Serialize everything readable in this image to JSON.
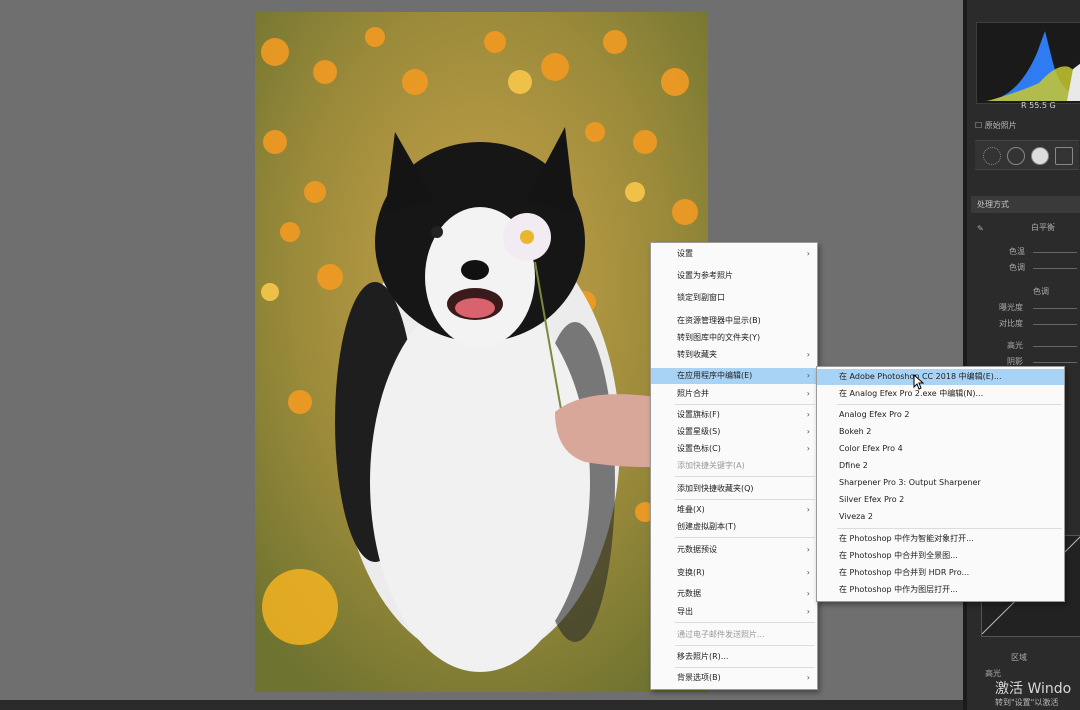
{
  "context_menu": {
    "items": [
      {
        "label": "设置",
        "submenu": true
      },
      {
        "label": "设置为参考照片"
      },
      {
        "label": "锁定到副窗口"
      },
      {
        "label": "在资源管理器中显示(B)"
      },
      {
        "label": "转到图库中的文件夹(Y)"
      },
      {
        "label": "转到收藏夹",
        "submenu": true
      },
      {
        "label": "在应用程序中编辑(E)",
        "submenu": true,
        "highlighted": true
      },
      {
        "label": "照片合并",
        "submenu": true
      },
      {
        "label": "设置旗标(F)",
        "submenu": true
      },
      {
        "label": "设置星级(S)",
        "submenu": true
      },
      {
        "label": "设置色标(C)",
        "submenu": true
      },
      {
        "label": "添加快捷关键字(A)",
        "disabled": true
      },
      {
        "label": "添加到快捷收藏夹(Q)"
      },
      {
        "label": "堆叠(X)",
        "submenu": true
      },
      {
        "label": "创建虚拟副本(T)"
      },
      {
        "label": "元数据预设",
        "submenu": true
      },
      {
        "label": "变换(R)",
        "submenu": true
      },
      {
        "label": "元数据",
        "submenu": true
      },
      {
        "label": "导出",
        "submenu": true
      },
      {
        "label": "通过电子邮件发送照片...",
        "disabled": true
      },
      {
        "label": "移去照片(R)..."
      },
      {
        "label": "背景选项(B)",
        "submenu": true
      }
    ]
  },
  "edit_submenu": {
    "items": [
      {
        "label": "在 Adobe Photoshop CC 2018 中编辑(E)...",
        "highlighted": true
      },
      {
        "label": "在 Analog Efex Pro 2.exe 中编辑(N)..."
      },
      {
        "label": "Analog Efex Pro 2"
      },
      {
        "label": "Bokeh 2"
      },
      {
        "label": "Color Efex Pro 4"
      },
      {
        "label": "Dfine 2"
      },
      {
        "label": "Sharpener Pro 3: Output Sharpener"
      },
      {
        "label": "Silver Efex Pro 2"
      },
      {
        "label": "Viveza 2"
      },
      {
        "label": "在 Photoshop 中作为智能对象打开..."
      },
      {
        "label": "在 Photoshop 中合并到全景图..."
      },
      {
        "label": "在 Photoshop 中合并到 HDR Pro..."
      },
      {
        "label": "在 Photoshop 中作为图层打开..."
      }
    ]
  },
  "right_panel": {
    "histogram_values": "R 55.5  G",
    "original_photo_label": "原始照片",
    "section_treatment": "处理方式",
    "wb_label": "白平衡",
    "temp_label": "色温",
    "tint_label": "色调",
    "tone_label": "色调",
    "exposure_label": "曝光度",
    "contrast_label": "对比度",
    "highlights_label": "高光",
    "shadows_label": "阴影",
    "curve_region_label": "区域",
    "highlights2_label": "高光",
    "watermark_text": "激活 Windo",
    "watermark_sub": "转到\"设置\"以激活"
  }
}
